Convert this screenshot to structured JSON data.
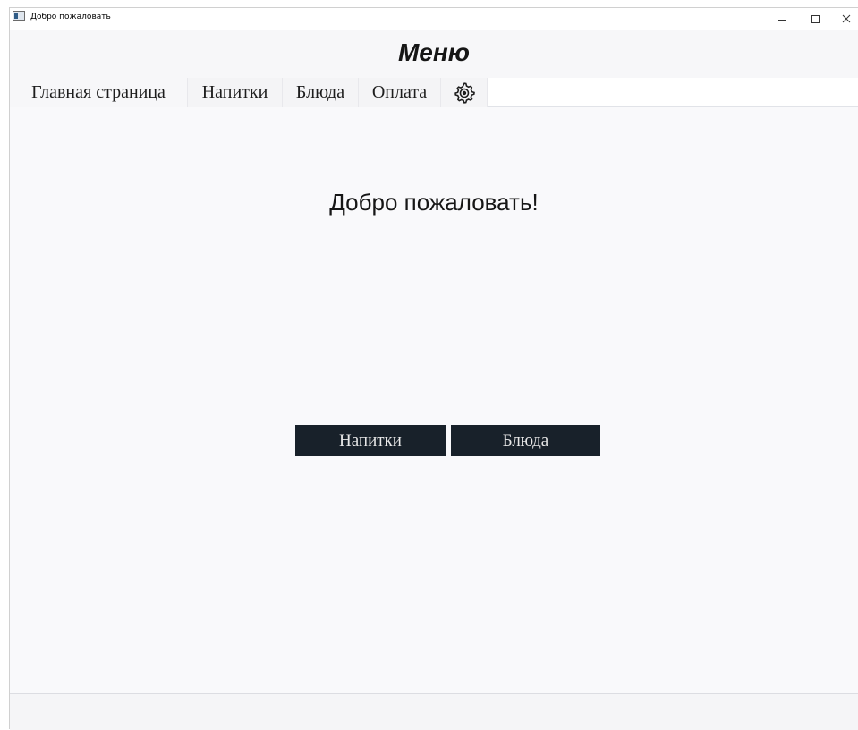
{
  "window": {
    "title": "Добро пожаловать",
    "controls": {
      "minimize": "–",
      "maximize": "□",
      "close": "✕"
    }
  },
  "header": {
    "title": "Меню"
  },
  "tabs": [
    {
      "label": "Главная страница",
      "active": true
    },
    {
      "label": "Напитки",
      "active": false
    },
    {
      "label": "Блюда",
      "active": false
    },
    {
      "label": "Оплата",
      "active": false
    },
    {
      "icon": "gear-icon",
      "active": false
    }
  ],
  "main": {
    "heading": "Добро пожаловать!",
    "buttons": {
      "drinks": "Напитки",
      "dishes": "Блюда"
    }
  },
  "colors": {
    "button_bg": "#18212a",
    "button_text": "#e8e8e8",
    "content_bg": "#f9f9fb"
  }
}
